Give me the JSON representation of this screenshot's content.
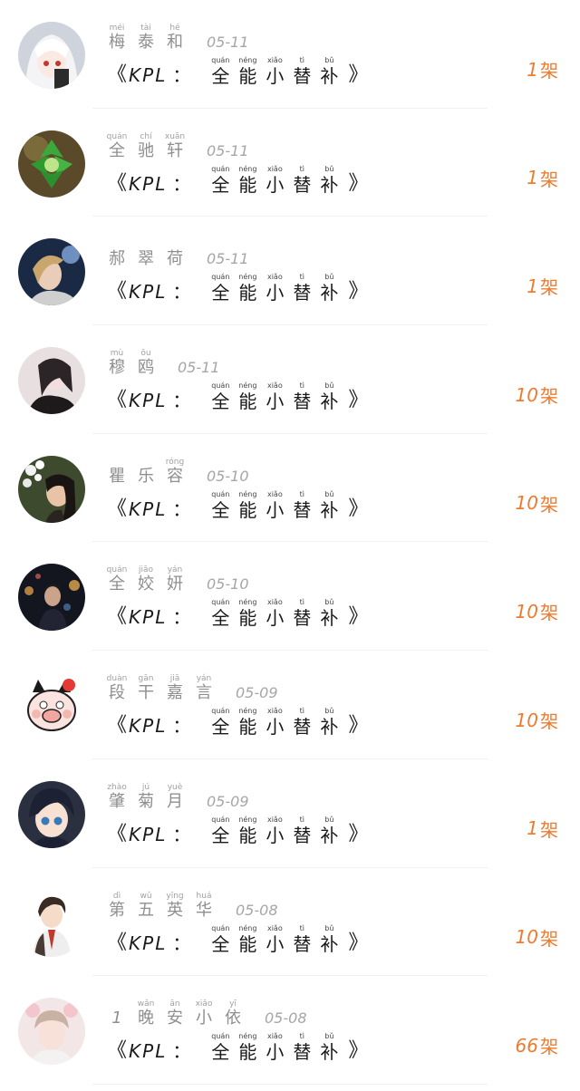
{
  "gift": {
    "open": "《",
    "code": "KPL",
    "colon": "：",
    "chars": [
      {
        "py": "quán",
        "hz": "全"
      },
      {
        "py": "néng",
        "hz": "能"
      },
      {
        "py": "xiǎo",
        "hz": "小"
      },
      {
        "py": "tì",
        "hz": "替"
      },
      {
        "py": "bǔ",
        "hz": "补"
      }
    ],
    "close": "》"
  },
  "unit": "架",
  "rows": [
    {
      "name": [
        {
          "py": "méi",
          "hz": "梅"
        },
        {
          "py": "tài",
          "hz": "泰"
        },
        {
          "py": "hé",
          "hz": "和"
        }
      ],
      "date": "05-11",
      "count": "1",
      "avatar": "anime-white-hair"
    },
    {
      "name": [
        {
          "py": "quán",
          "hz": "全"
        },
        {
          "py": "chí",
          "hz": "驰"
        },
        {
          "py": "xuān",
          "hz": "轩"
        }
      ],
      "date": "05-11",
      "count": "1",
      "avatar": "green-plant"
    },
    {
      "name": [
        {
          "py": "",
          "hz": "郝"
        },
        {
          "py": "",
          "hz": "翠"
        },
        {
          "py": "",
          "hz": "荷"
        }
      ],
      "date": "05-11",
      "count": "1",
      "avatar": "portrait-woman"
    },
    {
      "name": [
        {
          "py": "mù",
          "hz": "穆"
        },
        {
          "py": "ōu",
          "hz": "鸥"
        }
      ],
      "date": "05-11",
      "count": "10",
      "avatar": "portrait-dark"
    },
    {
      "name": [
        {
          "py": "",
          "hz": "瞿"
        },
        {
          "py": "",
          "hz": "乐"
        },
        {
          "py": "róng",
          "hz": "容"
        }
      ],
      "date": "05-10",
      "count": "10",
      "avatar": "woman-flowers"
    },
    {
      "name": [
        {
          "py": "quán",
          "hz": "全"
        },
        {
          "py": "jiāo",
          "hz": "姣"
        },
        {
          "py": "yán",
          "hz": "妍"
        }
      ],
      "date": "05-10",
      "count": "10",
      "avatar": "night-city"
    },
    {
      "name": [
        {
          "py": "duàn",
          "hz": "段"
        },
        {
          "py": "gān",
          "hz": "干"
        },
        {
          "py": "jiā",
          "hz": "嘉"
        },
        {
          "py": "yán",
          "hz": "言"
        }
      ],
      "date": "05-09",
      "count": "10",
      "avatar": "cartoon-pig"
    },
    {
      "name": [
        {
          "py": "zhào",
          "hz": "肇"
        },
        {
          "py": "jú",
          "hz": "菊"
        },
        {
          "py": "yuè",
          "hz": "月"
        }
      ],
      "date": "05-09",
      "count": "1",
      "avatar": "anime-dark-hair"
    },
    {
      "name": [
        {
          "py": "dì",
          "hz": "第"
        },
        {
          "py": "wǔ",
          "hz": "五"
        },
        {
          "py": "yīng",
          "hz": "英"
        },
        {
          "py": "huá",
          "hz": "华"
        }
      ],
      "date": "05-08",
      "count": "10",
      "avatar": "anime-boy"
    },
    {
      "name": [
        {
          "py": "",
          "hz": "1"
        },
        {
          "py": "wǎn",
          "hz": "晚"
        },
        {
          "py": "ān",
          "hz": "安"
        },
        {
          "py": "xiǎo",
          "hz": "小"
        },
        {
          "py": "yī",
          "hz": "依"
        }
      ],
      "date": "05-08",
      "count": "66",
      "avatar": "girl-pink"
    }
  ]
}
